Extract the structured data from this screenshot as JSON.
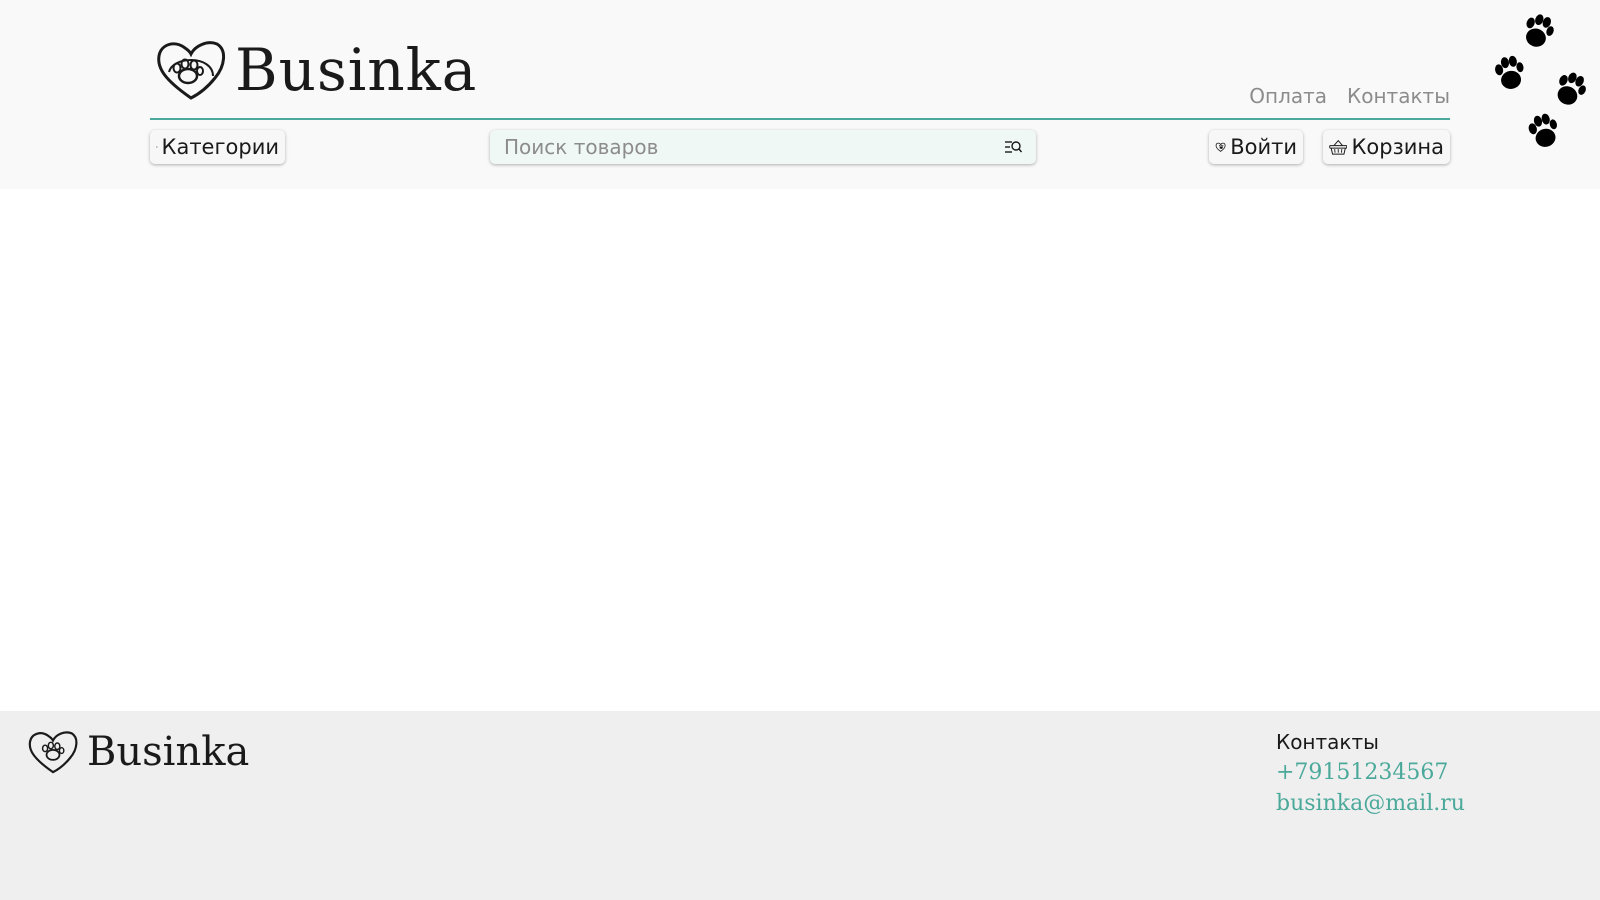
{
  "header": {
    "logo_text": "Businka",
    "nav_links": [
      {
        "label": "Оплата"
      },
      {
        "label": "Контакты"
      }
    ],
    "categories_label": "Категории",
    "search": {
      "placeholder": "Поиск товаров",
      "value": ""
    },
    "login_label": "Войти",
    "cart_label": "Корзина"
  },
  "footer": {
    "logo_text": "Businka",
    "contacts_title": "Контакты",
    "phone": "+79151234567",
    "email": "businka@mail.ru"
  },
  "colors": {
    "accent": "#4aa99a",
    "header_bg": "#f9f9f9",
    "footer_bg": "#efefef",
    "search_bg": "#eff8f5"
  }
}
